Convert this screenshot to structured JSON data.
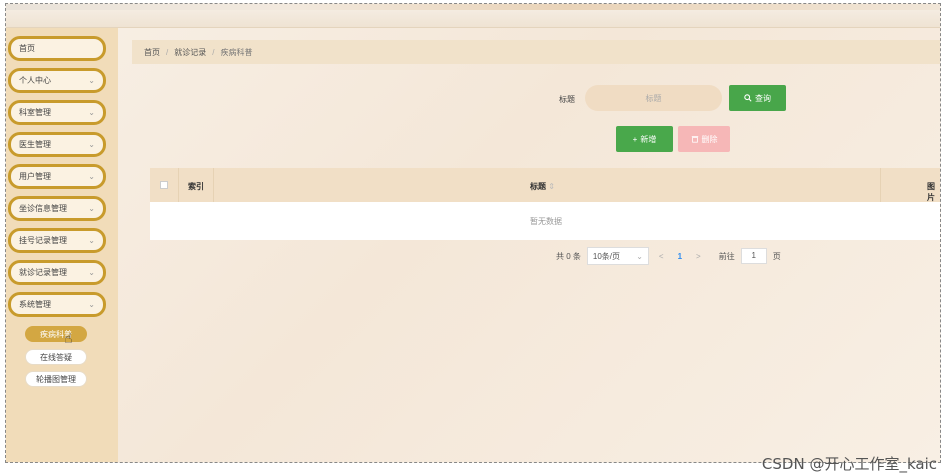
{
  "sidebar": {
    "items": [
      {
        "label": "首页",
        "has_arrow": false
      },
      {
        "label": "个人中心",
        "has_arrow": true
      },
      {
        "label": "科室管理",
        "has_arrow": true
      },
      {
        "label": "医生管理",
        "has_arrow": true
      },
      {
        "label": "用户管理",
        "has_arrow": true
      },
      {
        "label": "坐诊信息管理",
        "has_arrow": true
      },
      {
        "label": "挂号记录管理",
        "has_arrow": true
      },
      {
        "label": "就诊记录管理",
        "has_arrow": true
      },
      {
        "label": "系统管理",
        "has_arrow": true
      }
    ],
    "sub_items": [
      {
        "label": "疾病科普",
        "active": true
      },
      {
        "label": "在线答疑",
        "active": false
      },
      {
        "label": "轮播图管理",
        "active": false
      }
    ],
    "chevron": "⌄"
  },
  "breadcrumb": {
    "home": "首页",
    "level1": "就诊记录",
    "current": "疾病科普",
    "separator": "/"
  },
  "search": {
    "label": "标题",
    "placeholder": "标题",
    "query_button": "查询",
    "query_icon": "search-icon"
  },
  "actions": {
    "add_button": "新增",
    "add_icon": "plus-icon",
    "delete_button": "删除",
    "delete_icon": "trash-icon"
  },
  "table": {
    "columns": [
      "索引",
      "标题",
      "图片"
    ],
    "sort_indicator": "⇕",
    "empty_text": "暂无数据"
  },
  "pagination": {
    "total": "共 0 条",
    "page_size": "10条/页",
    "prev": "<",
    "current_page": "1",
    "next": ">",
    "goto_label": "前往",
    "goto_value": "1",
    "page_suffix": "页"
  },
  "watermark": "CSDN @开心工作室_kaic",
  "colors": {
    "sidebar_bg": "#f1dcb9",
    "sidebar_border": "#c89b2c",
    "active_sub": "#d3a742",
    "query_button": "#48a64a",
    "add_button": "#49a84b",
    "delete_button": "#f6b7b7",
    "table_header": "#f1dfc6"
  }
}
